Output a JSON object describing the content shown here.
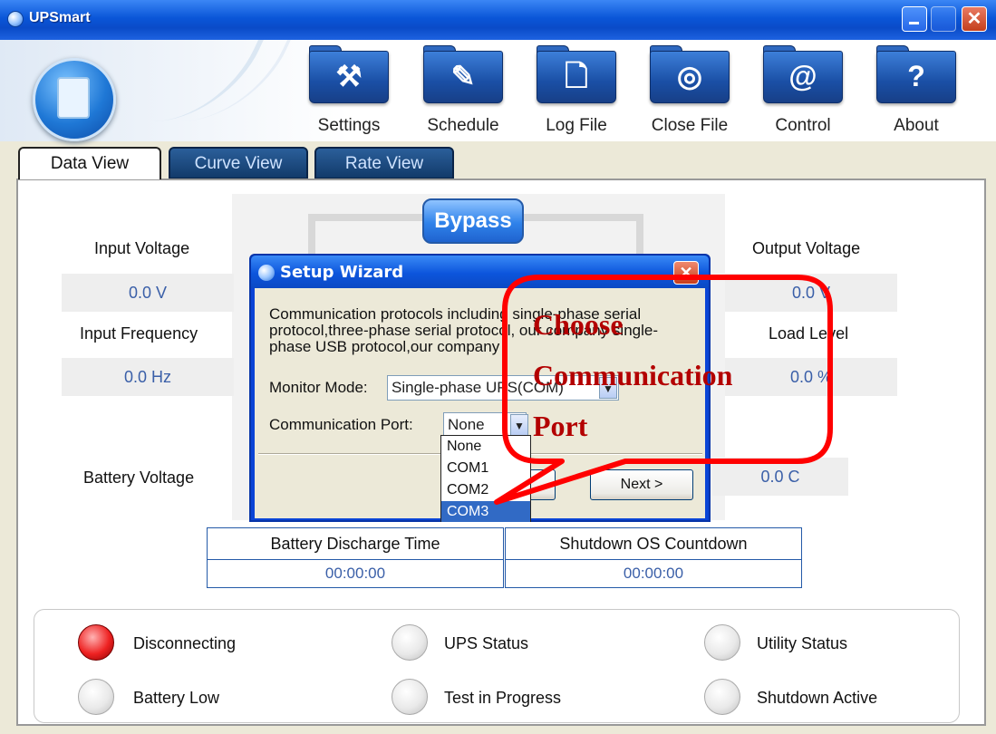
{
  "window": {
    "title": "UPSmart"
  },
  "toolbar": [
    {
      "label": "Settings",
      "icon": "hammer-icon"
    },
    {
      "label": "Schedule",
      "icon": "pencil-icon"
    },
    {
      "label": "Log File",
      "icon": "document-icon"
    },
    {
      "label": "Close File",
      "icon": "disc-icon"
    },
    {
      "label": "Control",
      "icon": "at-sign-icon"
    },
    {
      "label": "About",
      "icon": "question-icon"
    }
  ],
  "tabs": [
    {
      "label": "Data View",
      "active": true
    },
    {
      "label": "Curve View",
      "active": false
    },
    {
      "label": "Rate View",
      "active": false
    }
  ],
  "diagram": {
    "bypass_label": "Bypass"
  },
  "readings": {
    "input_voltage_label": "Input Voltage",
    "input_voltage_value": "0.0 V",
    "input_frequency_label": "Input Frequency",
    "input_frequency_value": "0.0 Hz",
    "battery_voltage_label": "Battery Voltage",
    "output_voltage_label": "Output Voltage",
    "output_voltage_value": "0.0 V",
    "load_level_label": "Load Level",
    "load_level_value": "0.0 %",
    "temperature_value": "0.0 C"
  },
  "dialog": {
    "title": "Setup Wizard",
    "description": "Communication protocols including single-phase serial protocol,three-phase serial protocol, our company single-phase USB protocol,our company",
    "monitor_mode_label": "Monitor Mode:",
    "monitor_mode_value": "Single-phase UPS(COM)",
    "port_label": "Communication Port:",
    "port_value": "None",
    "port_options": [
      "None",
      "COM1",
      "COM2",
      "COM3"
    ],
    "port_highlighted": "COM3",
    "back_label": "ck",
    "next_label": "Next >"
  },
  "annotation": {
    "line1": "Choose",
    "line2": "Communication",
    "line3": "Port",
    "color": "#ff0000"
  },
  "countdown": {
    "discharge_label": "Battery Discharge Time",
    "discharge_value": "00:00:00",
    "shutdown_label": "Shutdown OS Countdown",
    "shutdown_value": "00:00:00"
  },
  "status": [
    {
      "label": "Disconnecting",
      "state": "red"
    },
    {
      "label": "UPS Status",
      "state": "off"
    },
    {
      "label": "Utility Status",
      "state": "off"
    },
    {
      "label": "Battery Low",
      "state": "off"
    },
    {
      "label": "Test in Progress",
      "state": "off"
    },
    {
      "label": "Shutdown Active",
      "state": "off"
    }
  ]
}
